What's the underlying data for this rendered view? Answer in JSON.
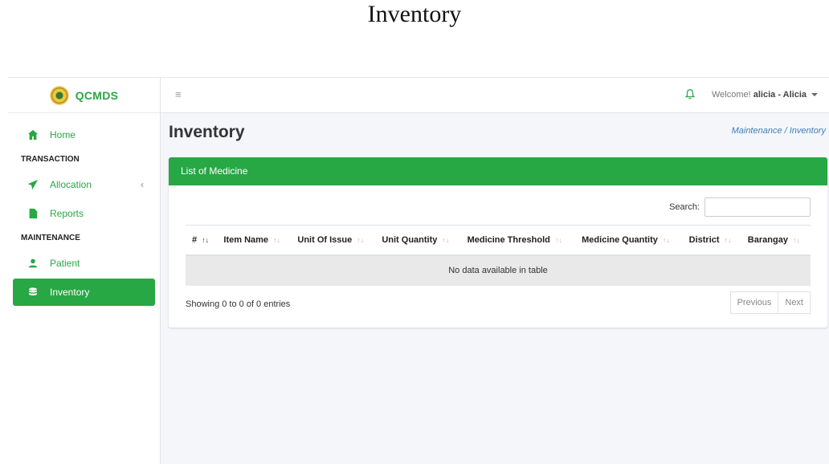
{
  "caption": "Inventory",
  "brand": {
    "name": "QCMDS",
    "logo": "qcmds-seal-logo"
  },
  "sidebar": {
    "home": "Home",
    "section_transaction": "TRANSACTION",
    "allocation": "Allocation",
    "reports": "Reports",
    "section_maintenance": "MAINTENANCE",
    "patient": "Patient",
    "inventory": "Inventory",
    "active": "Inventory"
  },
  "topbar": {
    "welcome_prefix": "Welcome!",
    "user": "alicia - Alicia"
  },
  "page": {
    "title": "Inventory",
    "breadcrumb": "Maintenance / Inventory"
  },
  "card": {
    "header": "List of Medicine",
    "search_label": "Search:",
    "columns": [
      "#",
      "Item Name",
      "Unit Of Issue",
      "Unit Quantity",
      "Medicine Threshold",
      "Medicine Quantity",
      "District",
      "Barangay"
    ],
    "empty_message": "No data available in table",
    "info": "Showing 0 to 0 of 0 entries",
    "prev": "Previous",
    "next": "Next"
  },
  "colors": {
    "accent": "#28a745",
    "link": "#3f7fb8"
  }
}
